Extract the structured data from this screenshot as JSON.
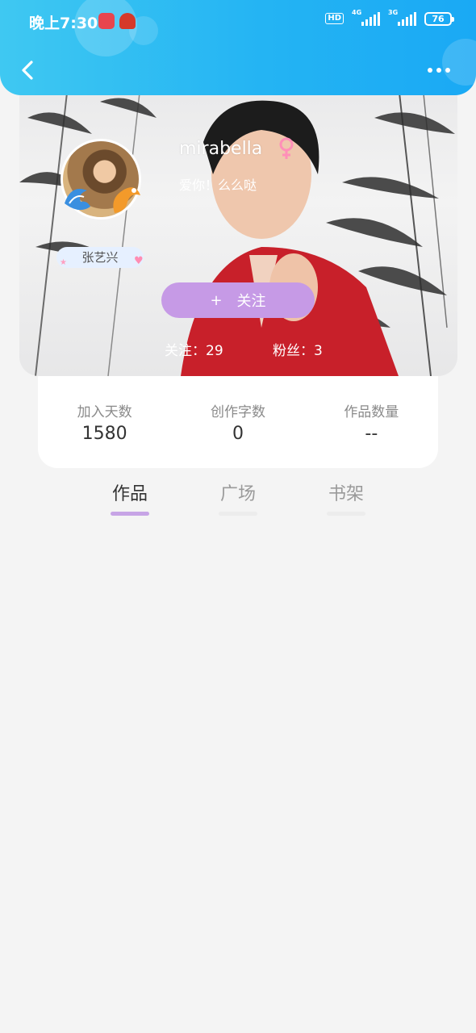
{
  "status_bar": {
    "time": "晚上7:30",
    "hd": "HD",
    "net1": "4G",
    "net2": "3G",
    "battery": "76"
  },
  "header": {
    "back_icon": "chevron-left-icon",
    "more_icon": "more-dots-icon"
  },
  "profile": {
    "username": "mirabella",
    "gender_icon": "female-icon",
    "signature": "爱你！么么哒",
    "tag": "张艺兴",
    "follow_label": "关注",
    "follow_plus": "+",
    "following": "关注：29",
    "fans": "粉丝：3"
  },
  "stats": [
    {
      "label": "加入天数",
      "value": "1580"
    },
    {
      "label": "创作字数",
      "value": "0"
    },
    {
      "label": "作品数量",
      "value": "--"
    }
  ],
  "tabs": [
    {
      "label": "作品",
      "active": true
    },
    {
      "label": "广场",
      "active": false
    },
    {
      "label": "书架",
      "active": false
    }
  ],
  "colors": {
    "header_blue": "#24b4f3",
    "follow_purple": "#c69ae6",
    "tab_active_underline": "#c7a4e6"
  }
}
